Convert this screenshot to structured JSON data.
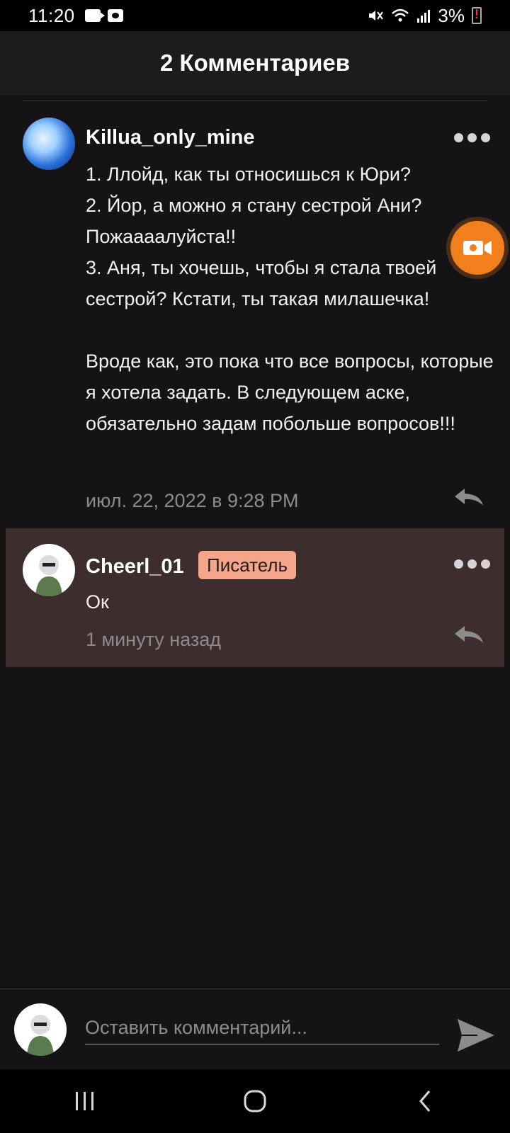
{
  "status_bar": {
    "time": "11:20",
    "battery": "3%"
  },
  "header": {
    "title": "2 Комментариев"
  },
  "comments": [
    {
      "author": "Killua_only_mine",
      "text": "1. Ллойд, как ты относишься к Юри?\n2. Йор, а можно я стану сестрой Ани? Пожаааалуйста!!\n3. Аня, ты хочешь, чтобы я стала твоей сестрой? Кстати, ты такая милашечка!\n\nВроде как, это пока что все вопросы, которые я хотела задать. В следующем аске, обязательно задам побольше вопросов!!!",
      "time": "июл. 22, 2022 в 9:28 PM"
    },
    {
      "author": "Cheerl_01",
      "badge": "Писатель",
      "text": "Ок",
      "time": "1 минуту назад"
    }
  ],
  "composer": {
    "placeholder": "Оставить комментарий..."
  },
  "colors": {
    "accent": "#f07f1c",
    "badge": "#f4a58a",
    "highlight_row": "#3d2d2d",
    "background": "#151316"
  },
  "icons": [
    "video-record-icon",
    "more-icon",
    "reply-icon",
    "send-icon",
    "recent-apps-icon",
    "home-icon",
    "back-icon"
  ]
}
